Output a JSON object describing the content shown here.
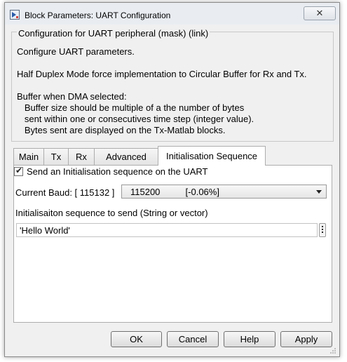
{
  "window": {
    "title": "Block Parameters: UART Configuration"
  },
  "description": {
    "legend": "Configuration for UART peripheral (mask) (link)",
    "lines": [
      "Configure UART parameters.",
      "Half Duplex Mode force implementation to Circular Buffer for Rx and Tx.",
      "Buffer when DMA selected:",
      "   Buffer size should be multiple of a the number of bytes",
      "   sent within one or consecutives time step (integer value).",
      "   Bytes sent are displayed on the Tx-Matlab blocks."
    ]
  },
  "tabs": [
    {
      "label": "Main",
      "active": false
    },
    {
      "label": "Tx",
      "active": false
    },
    {
      "label": "Rx",
      "active": false
    },
    {
      "label": "Advanced",
      "active": false
    },
    {
      "label": "Initialisation Sequence",
      "active": true
    }
  ],
  "init_sequence": {
    "checkbox_label": "Send an Initialisation sequence on the UART",
    "checkbox_checked": true,
    "baud_label": "Current Baud: [ 115132 ]",
    "baud_value": "115200          [-0.06%]",
    "sequence_label": "Initialisaiton sequence to send (String or vector)",
    "sequence_value": "'Hello World'"
  },
  "buttons": {
    "ok": "OK",
    "cancel": "Cancel",
    "help": "Help",
    "apply": "Apply"
  },
  "icons": {
    "app": "simulink-block-icon",
    "close": "close-icon",
    "more": "more-options-icon",
    "dropdown": "chevron-down-icon"
  }
}
